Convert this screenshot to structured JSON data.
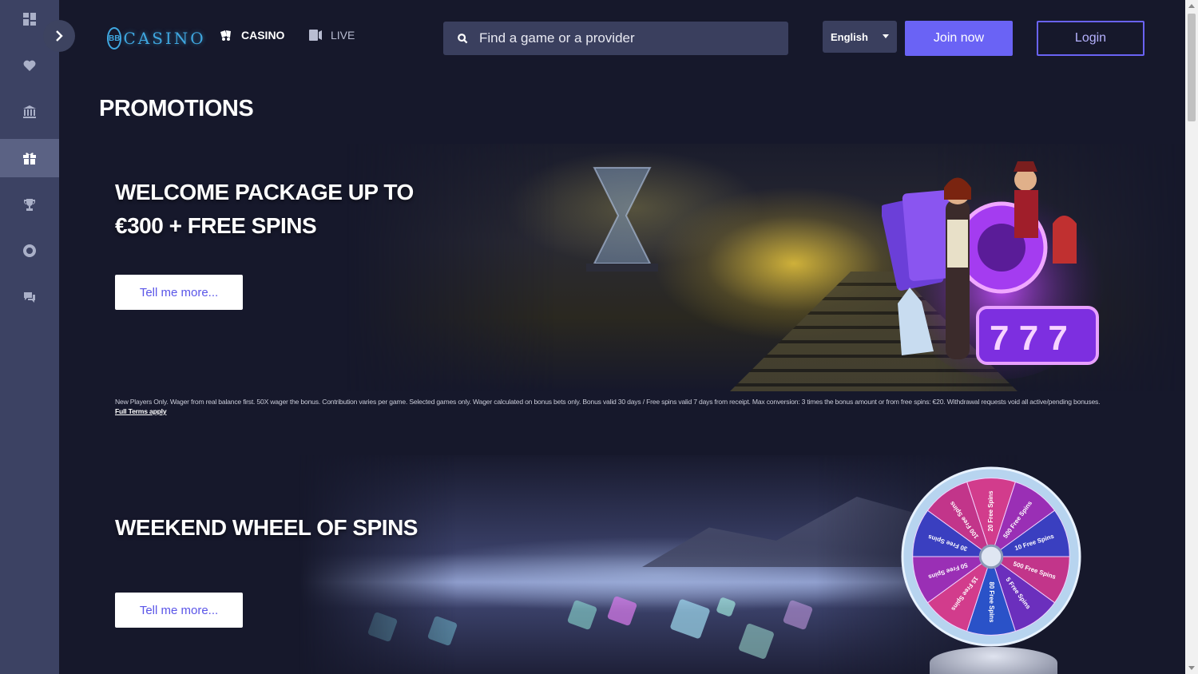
{
  "sidebar": {
    "items": [
      {
        "name": "dashboard-icon"
      },
      {
        "name": "heart-icon"
      },
      {
        "name": "casino-building-icon"
      },
      {
        "name": "gift-icon",
        "active": true
      },
      {
        "name": "trophy-icon"
      },
      {
        "name": "lifebuoy-icon"
      },
      {
        "name": "chat-icon"
      }
    ]
  },
  "header": {
    "logo_badge": "BB",
    "logo_text": "CASINO",
    "nav": [
      {
        "label": "CASINO",
        "icon": "cards-icon"
      },
      {
        "label": "LIVE",
        "icon": "live-dealer-icon"
      }
    ],
    "search_placeholder": "Find a game or a provider",
    "language": "English",
    "join_label": "Join now",
    "login_label": "Login"
  },
  "page_title": "PROMOTIONS",
  "promos": [
    {
      "heading_line1": "WELCOME PACKAGE UP TO",
      "heading_line2": "€300 + FREE SPINS",
      "button": "Tell me more...",
      "terms": "New Players Only. Wager from real balance first. 50X wager the bonus. Contribution varies per game. Selected games only. Wager calculated on bonus bets only. Bonus valid 30 days / Free spins valid 7 days from receipt. Max conversion: 3 times the bonus amount or from free spins: €20. Withdrawal requests void all active/pending bonuses.",
      "terms_link": "Full Terms apply"
    },
    {
      "heading_line1": "WEEKEND WHEEL OF SPINS",
      "button": "Tell me more..."
    }
  ],
  "wheel_segments": [
    "20 Free Spins",
    "500 Free Spins",
    "10 Free Spins",
    "500 Free Spins",
    "5 Free Spins",
    "80 Free Spins",
    "15 Free Spins",
    "50 Free Spins",
    "30 Free Spins",
    "100 Free Spins"
  ],
  "colors": {
    "accent": "#6a63f5",
    "sidebar": "#3c4263",
    "background": "#16182b"
  }
}
